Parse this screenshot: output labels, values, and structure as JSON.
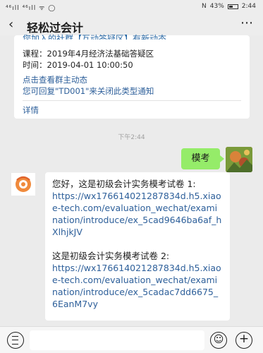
{
  "status_bar": {
    "signal_left": "⁴⁶ıll ⁴⁶ıll ᯤ ◯",
    "nfc": "N",
    "battery_percent": "43%",
    "time": "2:44"
  },
  "nav": {
    "back_glyph": "‹",
    "title": "轻松过会计",
    "more_glyph": "⋯"
  },
  "card": {
    "cut_top_text": "您加入的社群【互动答疑区】有新动态",
    "course_line": "课程：2019年4月经济法基础答疑区",
    "time_line": "时间：2019-04-01 10:00:50",
    "link_line1": "点击查看群主动态",
    "link_line2": "您可回复\"TD001\"来关闭此类型通知",
    "details_label": "详情"
  },
  "chat": {
    "timestamp": "下午2:44",
    "sent_message": "模考",
    "received": {
      "intro": "您好，这是初级会计实务模考试卷 1:",
      "url1": "https://wx176614021287834d.h5.xiaoe-tech.com/evaluation_wechat/examination/introduce/ex_5cad9646ba6af_hXlhjkJV",
      "intro2": "这是初级会计实务模考试卷 2:",
      "url2": "https://wx176614021287834d.h5.xiaoe-tech.com/evaluation_wechat/examination/introduce/ex_5cadac7dd6675_6EanM7vy"
    }
  },
  "input_bar": {
    "emoji_glyph": "☺",
    "plus_glyph": "+"
  },
  "colors": {
    "sent_bubble": "#95ec69",
    "link": "#2d5f9a",
    "background": "#ebebeb"
  }
}
